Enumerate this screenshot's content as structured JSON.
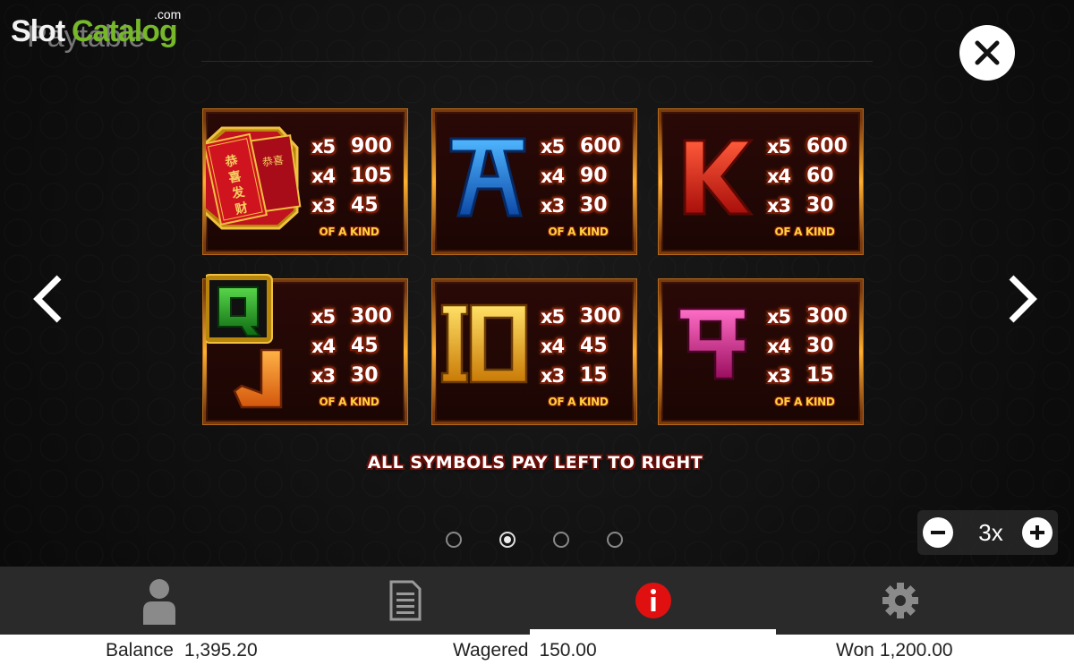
{
  "header": {
    "title": "Paytable",
    "watermark_slot": "Slot",
    "watermark_catalog": "Catalog",
    "watermark_com": ".com"
  },
  "paytable": {
    "cards": [
      {
        "symbol": "red-envelopes",
        "rows": [
          {
            "mult": "x5",
            "amt": "900"
          },
          {
            "mult": "x4",
            "amt": "105"
          },
          {
            "mult": "x3",
            "amt": "45"
          }
        ],
        "label": "OF A KIND"
      },
      {
        "symbol": "A",
        "rows": [
          {
            "mult": "x5",
            "amt": "600"
          },
          {
            "mult": "x4",
            "amt": "90"
          },
          {
            "mult": "x3",
            "amt": "30"
          }
        ],
        "label": "OF A KIND"
      },
      {
        "symbol": "K",
        "rows": [
          {
            "mult": "x5",
            "amt": "600"
          },
          {
            "mult": "x4",
            "amt": "60"
          },
          {
            "mult": "x3",
            "amt": "30"
          }
        ],
        "label": "OF A KIND"
      },
      {
        "symbol": "Q-J",
        "rows": [
          {
            "mult": "x5",
            "amt": "300"
          },
          {
            "mult": "x4",
            "amt": "45"
          },
          {
            "mult": "x3",
            "amt": "30"
          }
        ],
        "label": "OF A KIND"
      },
      {
        "symbol": "10",
        "rows": [
          {
            "mult": "x5",
            "amt": "300"
          },
          {
            "mult": "x4",
            "amt": "45"
          },
          {
            "mult": "x3",
            "amt": "15"
          }
        ],
        "label": "OF A KIND"
      },
      {
        "symbol": "9",
        "rows": [
          {
            "mult": "x5",
            "amt": "300"
          },
          {
            "mult": "x4",
            "amt": "30"
          },
          {
            "mult": "x3",
            "amt": "15"
          }
        ],
        "label": "OF A KIND"
      }
    ],
    "banner": "ALL SYMBOLS PAY LEFT TO RIGHT",
    "envelope_chars_1": "恭喜发财",
    "envelope_chars_2": "恭喜"
  },
  "pagination": {
    "pages": 4,
    "active": 2
  },
  "zoom": {
    "value": "3x"
  },
  "toolbar": {
    "items": [
      "profile-icon",
      "history-icon",
      "info-icon",
      "settings-icon"
    ],
    "active": "info"
  },
  "status": {
    "balance_label": "Balance",
    "balance_value": "1,395.20",
    "wagered_label": "Wagered",
    "wagered_value": "150.00",
    "won_label": "Won",
    "won_value": "1,200.00"
  },
  "colors": {
    "info_accent": "#e01010",
    "watermark_green": "#76b82a",
    "card_border": "#b36a1a"
  }
}
